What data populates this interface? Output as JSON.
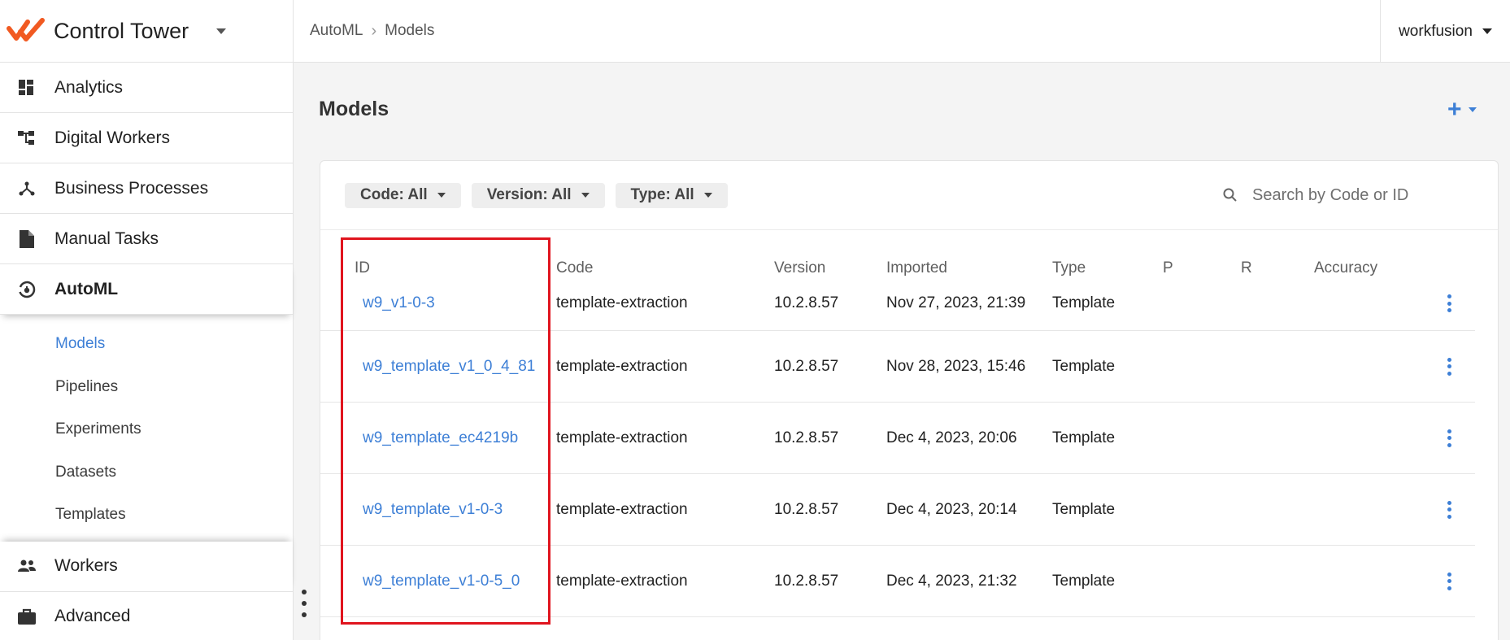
{
  "app": {
    "name": "Control Tower",
    "user": "workfusion",
    "brand_color": "#f15a22",
    "accent_color": "#3d7fd6",
    "highlight_color": "#e0141e"
  },
  "breadcrumb": [
    "AutoML",
    "Models"
  ],
  "sidebar": {
    "items": [
      {
        "label": "Analytics",
        "icon": "dashboard-icon"
      },
      {
        "label": "Digital Workers",
        "icon": "hierarchy-icon"
      },
      {
        "label": "Business Processes",
        "icon": "process-icon"
      },
      {
        "label": "Manual Tasks",
        "icon": "document-icon"
      },
      {
        "label": "AutoML",
        "icon": "automl-icon"
      }
    ],
    "automl_sub": [
      "Models",
      "Pipelines",
      "Experiments",
      "Datasets",
      "Templates"
    ],
    "bottom_items": [
      {
        "label": "Workers",
        "icon": "people-icon"
      },
      {
        "label": "Advanced",
        "icon": "briefcase-icon"
      }
    ]
  },
  "page": {
    "title": "Models",
    "add_label": "+"
  },
  "filters": [
    "Code: All",
    "Version: All",
    "Type: All"
  ],
  "search": {
    "placeholder": "Search by Code or ID"
  },
  "table": {
    "headers": [
      "ID",
      "Code",
      "Version",
      "Imported",
      "Type",
      "P",
      "R",
      "Accuracy"
    ],
    "rows": [
      {
        "id": "w9_v1-0-3",
        "code": "template-extraction",
        "version": "10.2.8.57",
        "imported": "Nov 27, 2023, 21:39",
        "type": "Template"
      },
      {
        "id": "w9_template_v1_0_4_81",
        "code": "template-extraction",
        "version": "10.2.8.57",
        "imported": "Nov 28, 2023, 15:46",
        "type": "Template"
      },
      {
        "id": "w9_template_ec4219b",
        "code": "template-extraction",
        "version": "10.2.8.57",
        "imported": "Dec 4, 2023, 20:06",
        "type": "Template"
      },
      {
        "id": "w9_template_v1-0-3",
        "code": "template-extraction",
        "version": "10.2.8.57",
        "imported": "Dec 4, 2023, 20:14",
        "type": "Template"
      },
      {
        "id": "w9_template_v1-0-5_0",
        "code": "template-extraction",
        "version": "10.2.8.57",
        "imported": "Dec 4, 2023, 21:32",
        "type": "Template"
      }
    ]
  }
}
